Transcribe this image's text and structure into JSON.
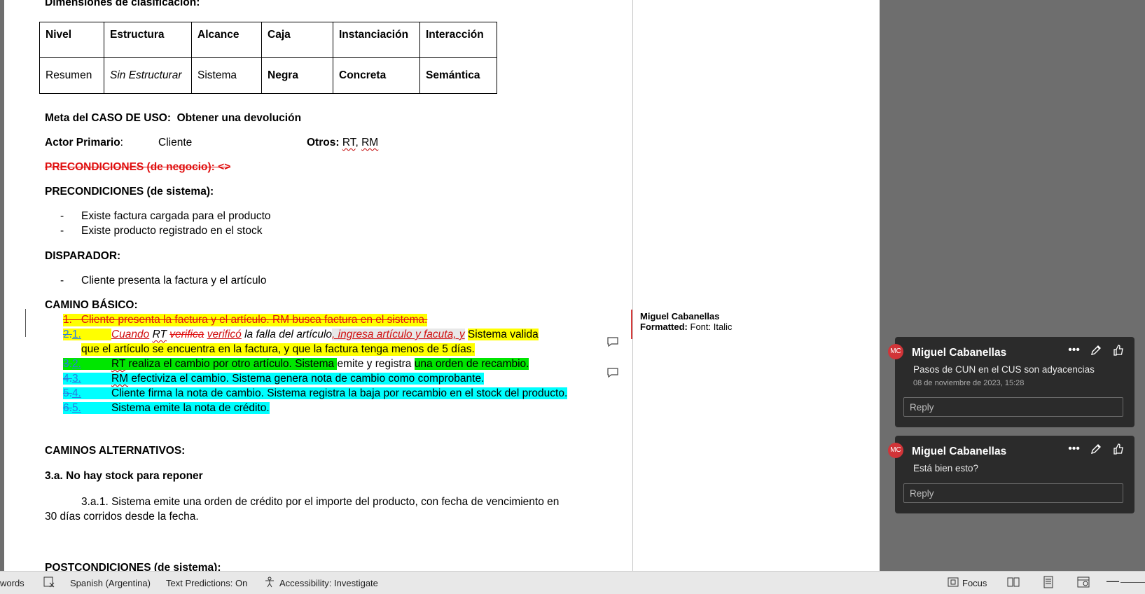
{
  "document": {
    "heading_dimensions": "Dimensiones de clasificación:",
    "table": {
      "headers": [
        "Nivel",
        "Estructura",
        "Alcance",
        "Caja",
        "Instanciación",
        "Interacción"
      ],
      "row": [
        "Resumen",
        "Sin Estructurar",
        "Sistema",
        "Negra",
        "Concreta",
        "Semántica"
      ]
    },
    "meta_label": "Meta del CASO DE USO:",
    "meta_value": "Obtener una devolución",
    "actor_label": "Actor Primario",
    "actor_colon": ":",
    "actor_value": "Cliente",
    "otros_label": "Otros:",
    "otros_rt": "RT",
    "otros_sep": ", ",
    "otros_rm": "RM",
    "precond_negocio": "PRECONDICIONES (de negocio): <>",
    "precond_sistema": "PRECONDICIONES (de sistema):",
    "precond_items": [
      "Existe factura cargada para el producto",
      "Existe producto registrado en el stock"
    ],
    "disparador": "DISPARADOR:",
    "disparador_items": [
      "Cliente presenta la factura y el artículo"
    ],
    "camino_basico": "CAMINO BÁSICO:",
    "step1_deleted": "1.   Cliente presenta la factura y el artículo. RM busca factura en el sistema.",
    "step2": {
      "num_old": "2.",
      "num_new": "1.",
      "cuando": "Cuando",
      "rt": "RT",
      "verifica": "verifica",
      "verifico": "verificó",
      "falla": "la falla del artículo",
      "ins": ", ingresa artículo y facuta, y",
      "rest1": "Sistema valida",
      "line2": "que el artículo se encuentra en la factura, y que la factura tenga menos de 5 días."
    },
    "step3": {
      "num_old": "3.",
      "num_new": "2.",
      "rt": "RT",
      "a": " realiza el cambio por otro artículo. Sistema ",
      "b": "emite y registra ",
      "c": "una orden de recambio."
    },
    "step4": {
      "num_old": "4.",
      "num_new": "3.",
      "rm": "RM",
      "text": " efectiviza el cambio. Sistema genera nota de cambio como comprobante."
    },
    "step5": {
      "num_old": "5.",
      "num_new": "4.",
      "text": "Cliente firma la nota de cambio. Sistema registra la baja por recambio en el stock del producto."
    },
    "step6": {
      "num_old": "6.",
      "num_new": "5.",
      "text": "Sistema emite la nota de crédito."
    },
    "caminos_alt": "CAMINOS ALTERNATIVOS:",
    "alt_3a": "3.a. No hay stock para reponer",
    "alt_3a1_line1": "3.a.1. Sistema emite una orden de crédito por el importe del producto, con fecha de vencimiento en",
    "alt_3a1_line2": "30 días corridos desde la fecha.",
    "postcond": "POSTCONDICIONES (de sistema):"
  },
  "markup_balloon": {
    "author": "Miguel Cabanellas",
    "label": "Formatted:",
    "value": "Font: Italic"
  },
  "comments": [
    {
      "initials": "MC",
      "author": "Miguel Cabanellas",
      "text": "Pasos de CUN en el CUS son adyacencias",
      "timestamp": "08 de noviembre de 2023, 15:28",
      "reply_placeholder": "Reply"
    },
    {
      "initials": "MC",
      "author": "Miguel Cabanellas",
      "text": "Está bien esto?",
      "reply_placeholder": "Reply"
    }
  ],
  "status_bar": {
    "words": "words",
    "language": "Spanish (Argentina)",
    "text_predictions": "Text Predictions: On",
    "accessibility": "Accessibility: Investigate",
    "focus": "Focus"
  },
  "colors": {
    "highlight_yellow": "#ffff00",
    "highlight_green": "#00e600",
    "highlight_cyan": "#00ffff",
    "deletion_red": "#e01010",
    "avatar_red": "#d13438"
  }
}
